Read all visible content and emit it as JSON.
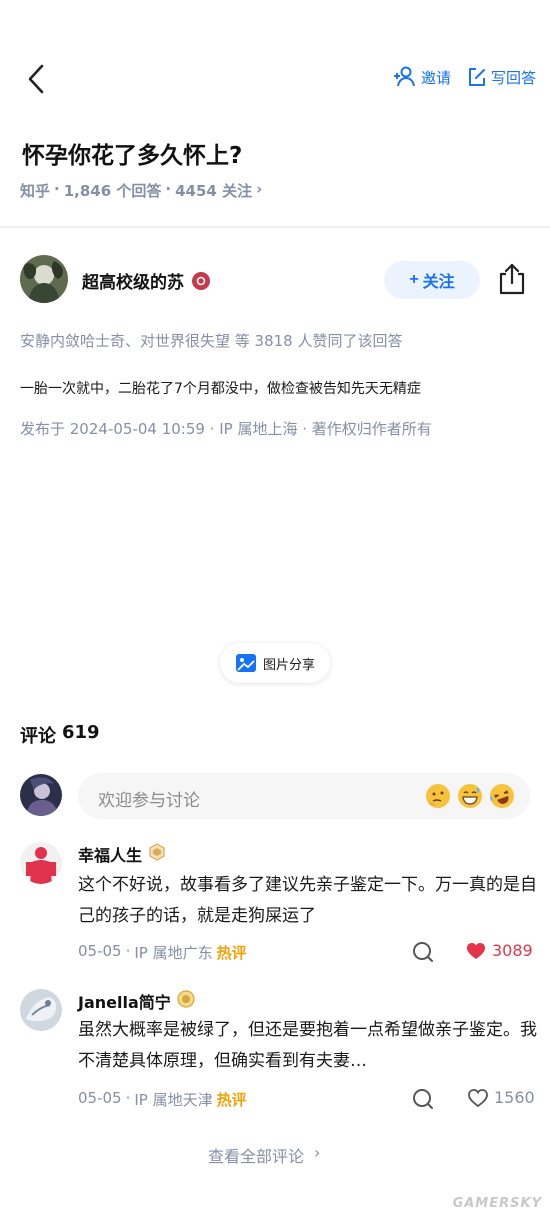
{
  "nav": {
    "invite_label": "邀请",
    "write_label": "写回答"
  },
  "question": {
    "title": "怀孕你花了多久怀上?",
    "source": "知乎",
    "answers": "1,846 个回答",
    "follows": "4454 关注",
    "meta_sep": "·",
    "meta_arrow": "›"
  },
  "author": {
    "name": "超高校级的苏",
    "follow_label": "关注",
    "follow_plus": "+"
  },
  "answer": {
    "likers": "安静内敛哈士奇、对世界很失望 等 3818 人赞同了该回答",
    "text": "一胎一次就中，二胎花了7个月都没中，做检查被告知先天无精症",
    "published": "发布于 2024-05-04 10:59 · IP 属地上海 · 著作权归作者所有"
  },
  "image_share": {
    "label": "图片分享"
  },
  "comments": {
    "heading": "评论",
    "count": "619",
    "input_placeholder": "欢迎参与讨论",
    "items": [
      {
        "name": "幸福人生",
        "text": "这个不好说，故事看多了建议先亲子鉴定一下。万一真的是自己的孩子的话，就是走狗屎运了",
        "date": "05-05",
        "location": "IP 属地广东",
        "tag": "热评",
        "likes": "3089",
        "liked": true
      },
      {
        "name": "Janella简宁",
        "text": "虽然大概率是被绿了，但还是要抱着一点希望做亲子鉴定。我不清楚具体原理，但确实看到有夫妻…",
        "date": "05-05",
        "location": "IP 属地天津",
        "tag": "热评",
        "likes": "1560",
        "liked": false
      }
    ],
    "see_all": "查看全部评论",
    "see_all_arrow": "›"
  },
  "watermark": "GAMERSKY",
  "colors": {
    "accent": "#1772f6",
    "muted": "#8590a6",
    "hot": "#f1a30d",
    "like_red": "#e3344a"
  }
}
